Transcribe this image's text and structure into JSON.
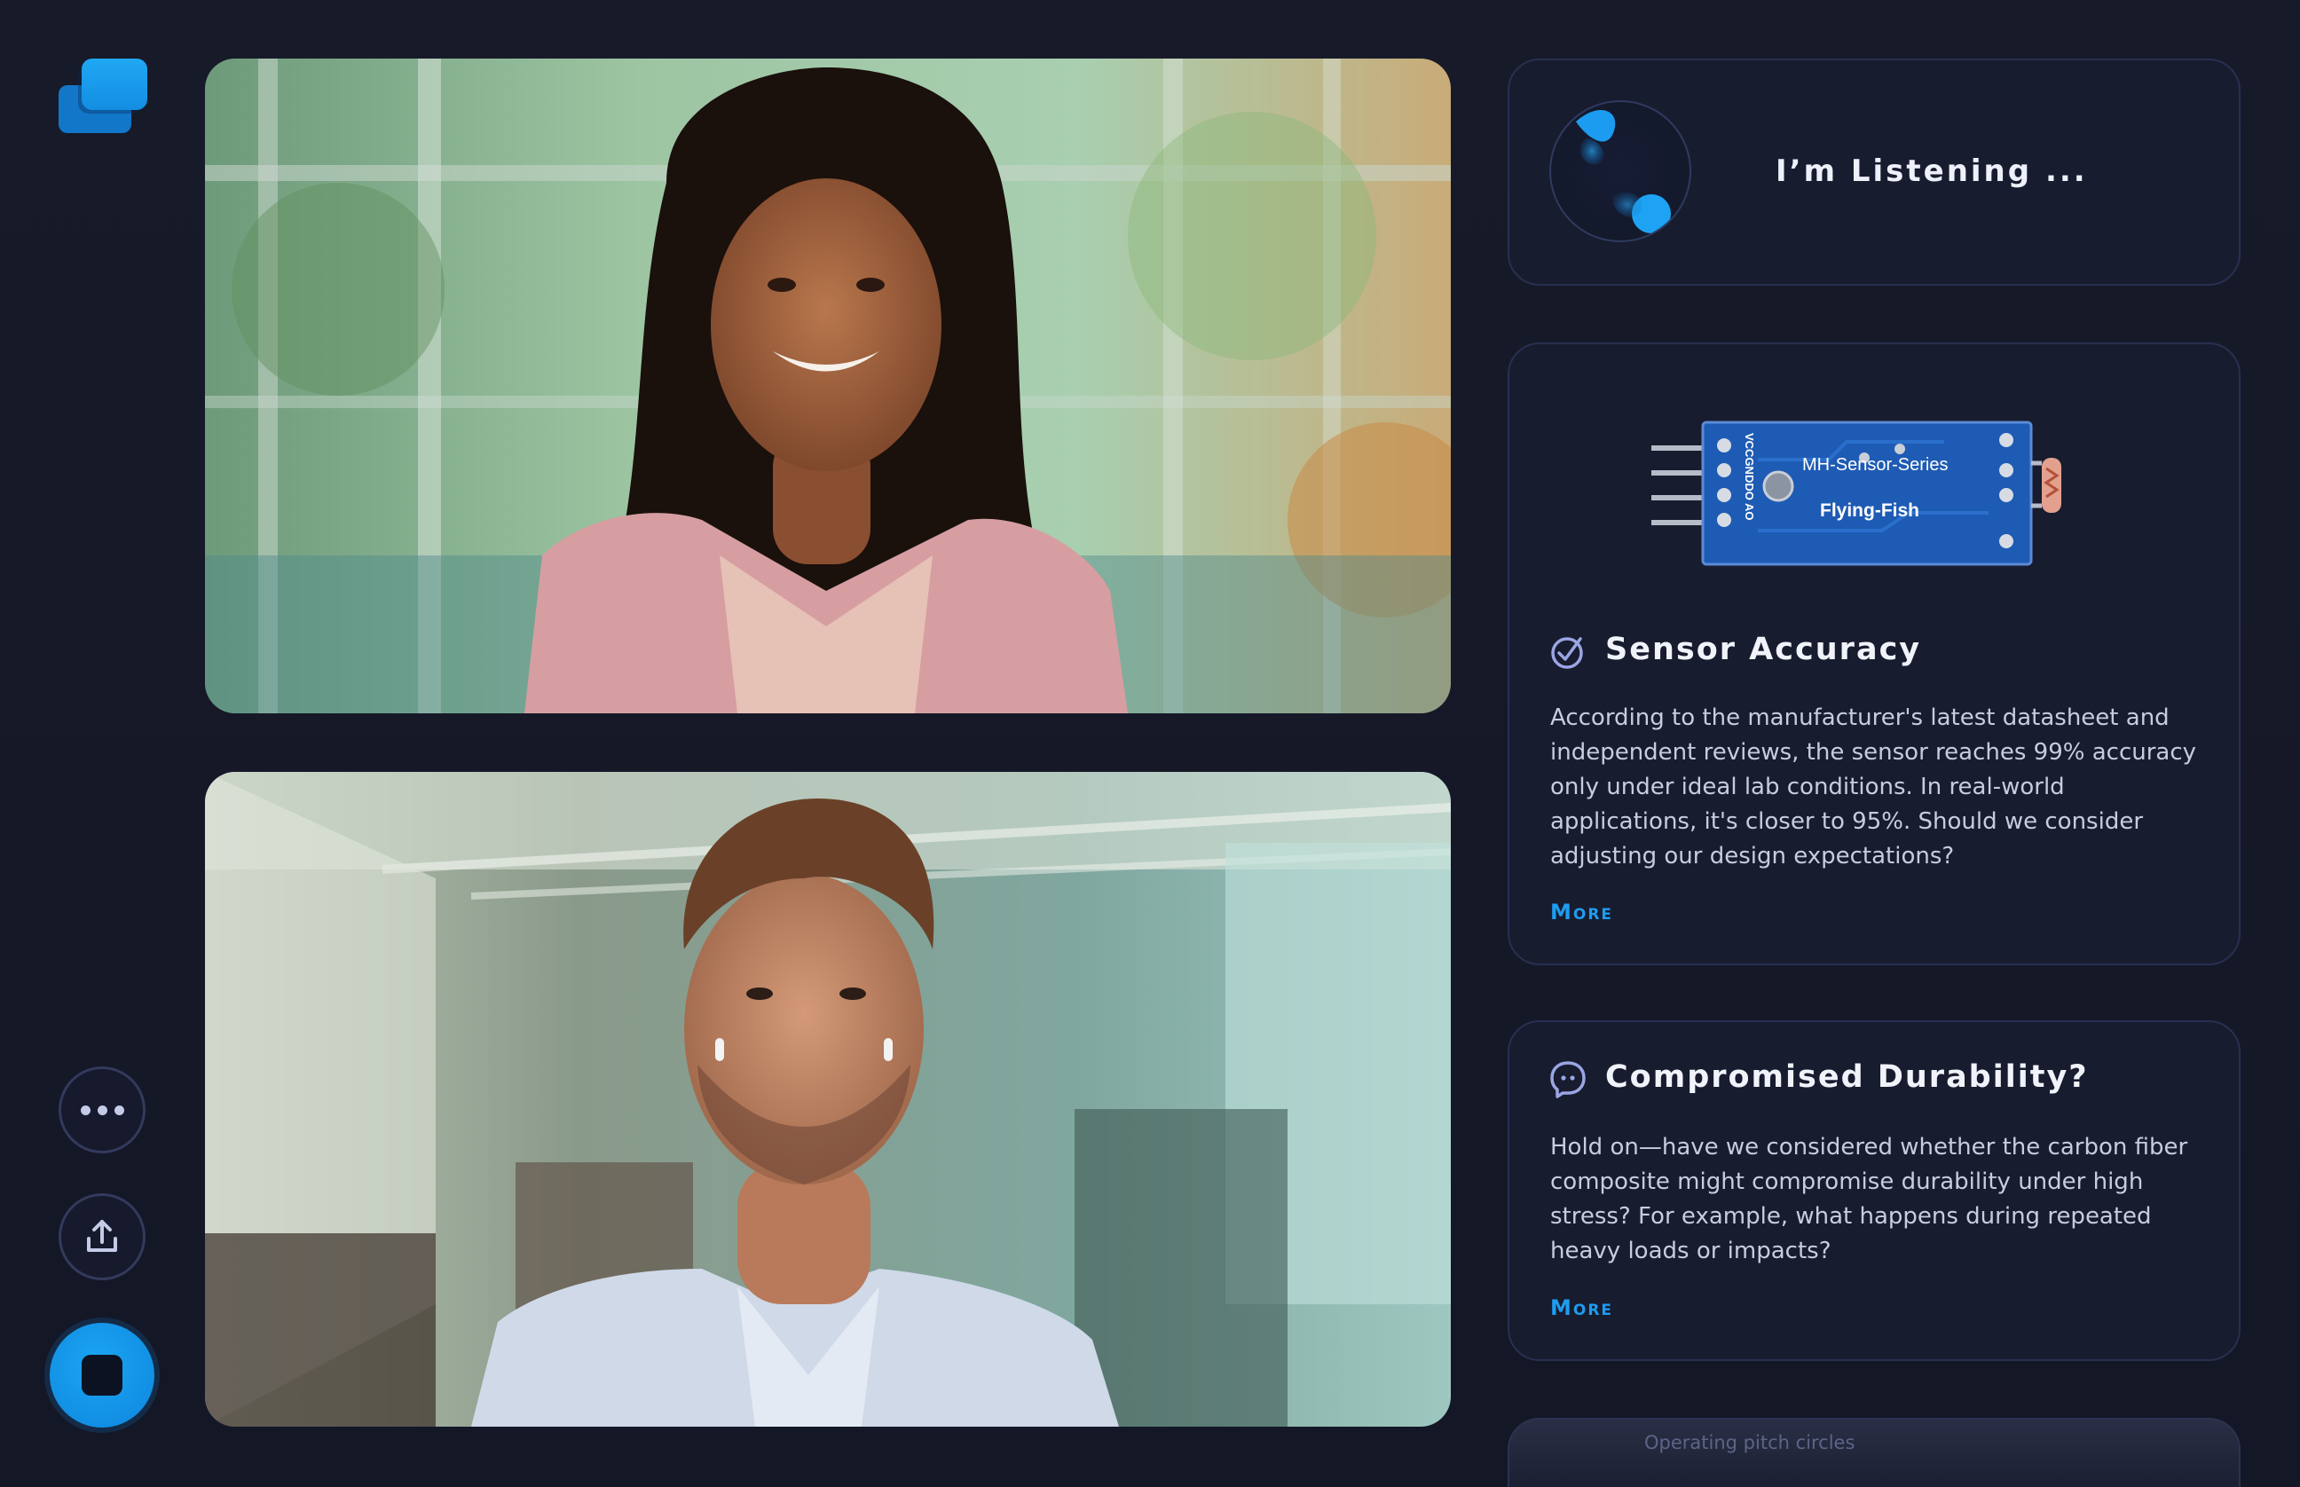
{
  "assistant": {
    "status_text": "I’m Listening ..."
  },
  "controls": {
    "more_icon": "ellipsis-icon",
    "share_icon": "upload-icon",
    "stop_icon": "stop-icon"
  },
  "insights": [
    {
      "icon": "target-check-icon",
      "title": "Sensor Accuracy",
      "image": {
        "label_line1": "MH-Sensor-Series",
        "label_line2": "Flying-Fish",
        "pins": "VCCGNDDO AO"
      },
      "body": "According to the manufacturer's latest datasheet and independent reviews, the sensor reaches 99% accuracy only under ideal lab conditions. In real-world applications, it's closer to 95%. Should we consider adjusting our design expectations?",
      "more_label": "More"
    },
    {
      "icon": "chat-bubble-icon",
      "title": "Compromised Durability?",
      "body": "Hold on—have we considered whether the carbon fiber composite might compromise durability under high stress? For example, what happens during repeated heavy loads or impacts?",
      "more_label": "More"
    },
    {
      "peek_text": "Operating pitch circles"
    }
  ],
  "colors": {
    "accent": "#1e9cf0",
    "background": "#151827",
    "card": "#181c2f"
  }
}
